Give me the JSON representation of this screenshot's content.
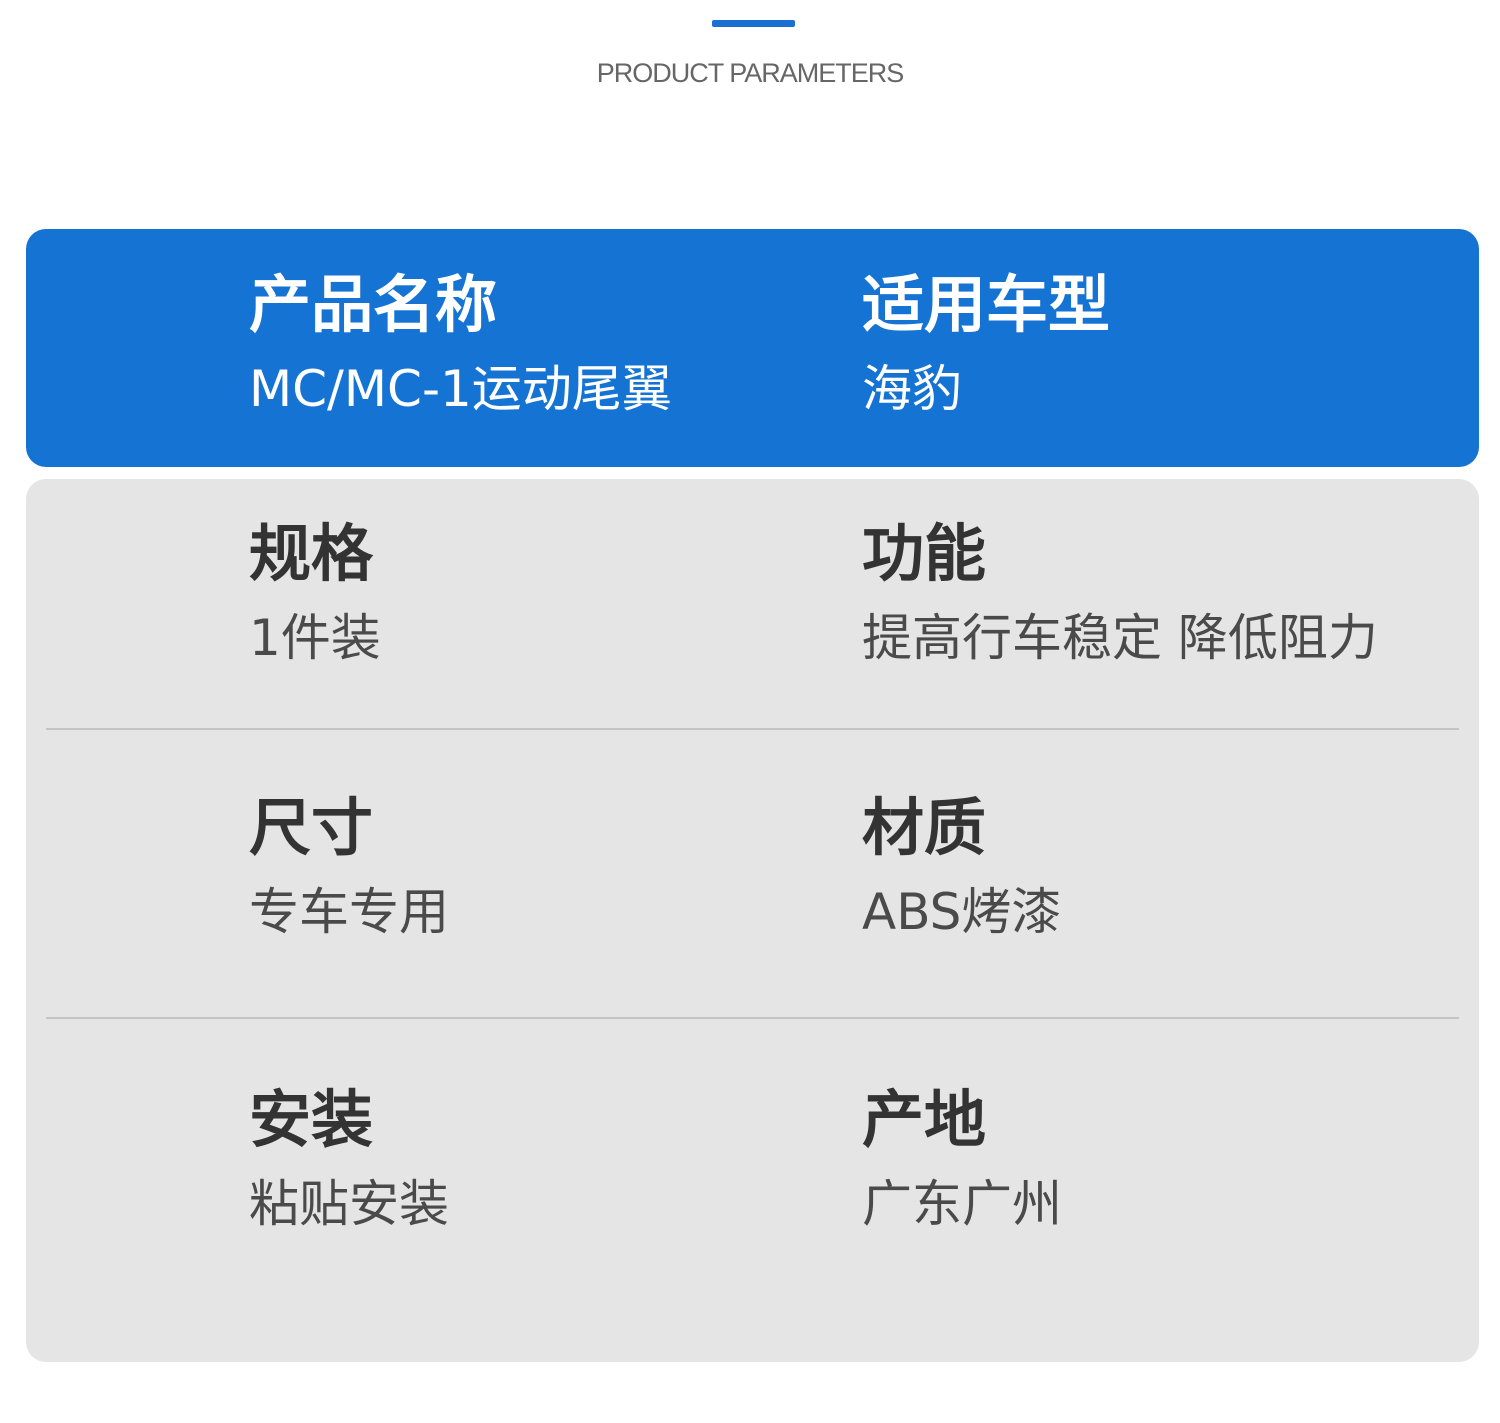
{
  "section": {
    "subtitle": "PRODUCT PARAMETERS"
  },
  "colors": {
    "accent": "#1573d3",
    "card_bg": "#e5e5e5",
    "label_text": "#333333",
    "value_text": "#4a4a4a"
  },
  "header": {
    "product_name": {
      "label": "产品名称",
      "value": "MC/MC-1运动尾翼"
    },
    "vehicle_model": {
      "label": "适用车型",
      "value": "海豹"
    }
  },
  "params": {
    "spec": {
      "label": "规格",
      "value": "1件装"
    },
    "function": {
      "label": "功能",
      "value": "提高行车稳定 降低阻力"
    },
    "size": {
      "label": "尺寸",
      "value": "专车专用"
    },
    "material": {
      "label": "材质",
      "value": "ABS烤漆"
    },
    "install": {
      "label": "安装",
      "value": "粘贴安装"
    },
    "origin": {
      "label": "产地",
      "value": "广东广州"
    }
  }
}
